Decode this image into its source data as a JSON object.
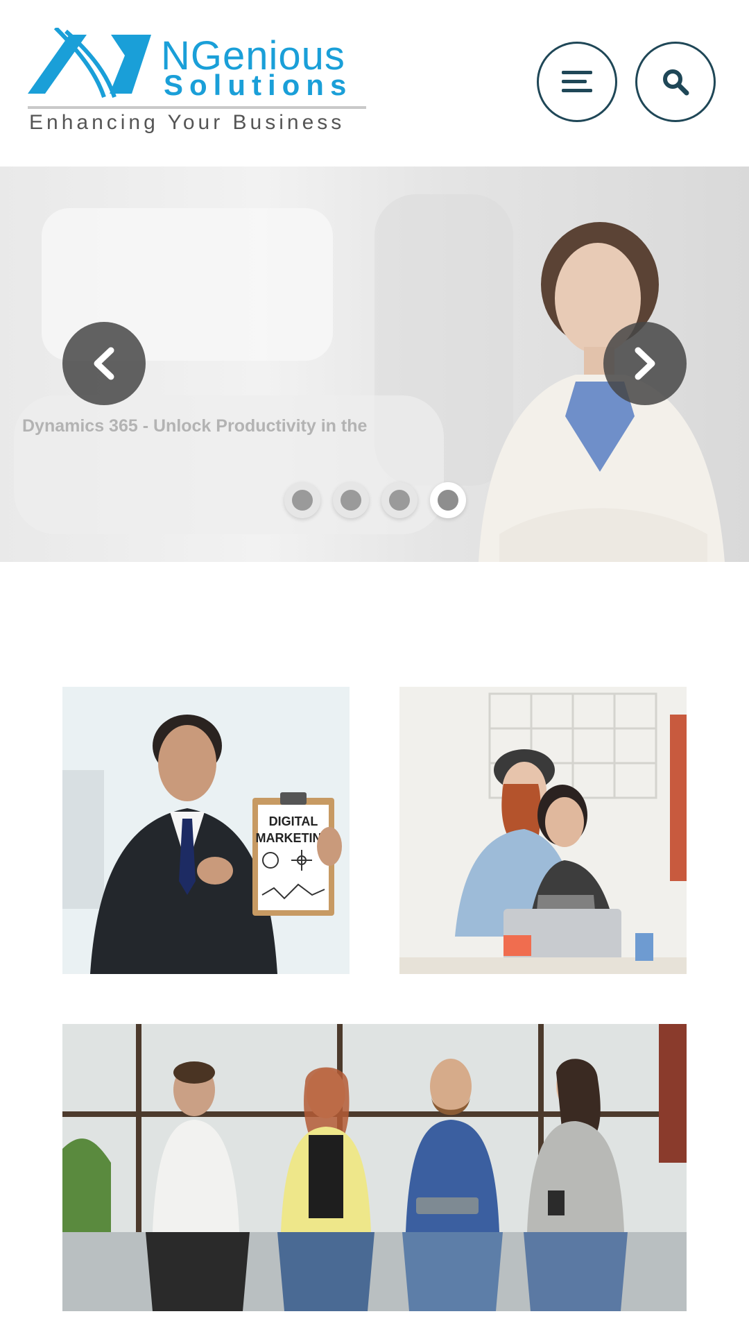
{
  "header": {
    "logo": {
      "title": "NGenious",
      "subtitle": "Solutions",
      "tagline": "Enhancing Your Business"
    },
    "menu_icon": "hamburger-icon",
    "search_icon": "search-icon"
  },
  "slider": {
    "caption": "Dynamics 365 - Unlock Productivity in the",
    "prev_icon": "chevron-left-icon",
    "next_icon": "chevron-right-icon",
    "dots": [
      {
        "active": false
      },
      {
        "active": false
      },
      {
        "active": false
      },
      {
        "active": true
      }
    ]
  },
  "tiles": [
    {
      "clipboard_text_line1": "DIGITAL",
      "clipboard_text_line2": "MARKETING"
    },
    {},
    {}
  ],
  "colors": {
    "brand_blue": "#1a9fd8",
    "button_border": "#1f4757",
    "arrow_bg": "#464646"
  }
}
